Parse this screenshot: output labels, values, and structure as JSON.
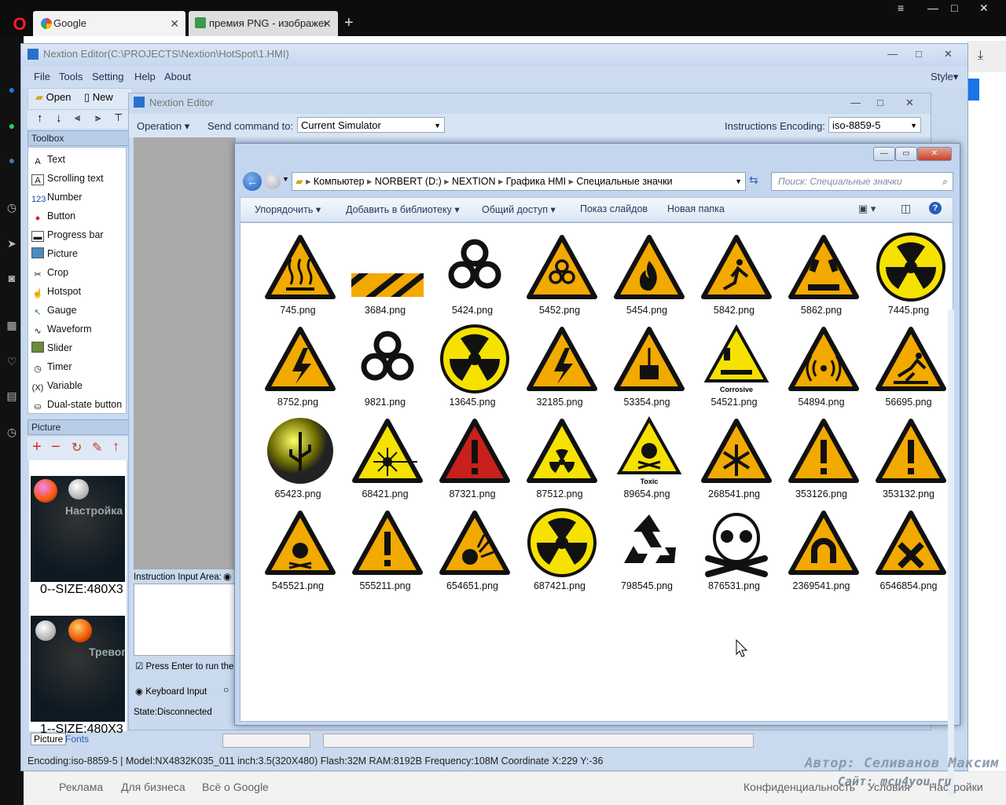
{
  "browser": {
    "tabs": [
      {
        "label": "Google"
      },
      {
        "label": "премия PNG - изображен"
      }
    ],
    "new_tab": "+",
    "footer_links": [
      "Реклама",
      "Для бизнеса",
      "Всё о Google",
      "Конфиденциальность",
      "Условия",
      "Настройки"
    ]
  },
  "nextion": {
    "title": "Nextion Editor(C:\\PROJECTS\\Nextion\\HotSpot\\1.HMI)",
    "menu": [
      "File",
      "Tools",
      "Setting",
      "Help",
      "About"
    ],
    "style_label": "Style",
    "toolbar": {
      "open": "Open",
      "new": "New"
    },
    "toolbox_title": "Toolbox",
    "tools": [
      "Text",
      "Scrolling text",
      "Number",
      "Button",
      "Progress bar",
      "Picture",
      "Crop",
      "Hotspot",
      "Gauge",
      "Waveform",
      "Slider",
      "Timer",
      "Variable",
      "Dual-state button"
    ],
    "picture_title": "Picture",
    "pictures": [
      {
        "caption": "Настройка",
        "label": "0--SIZE:480X3"
      },
      {
        "caption": "Тревог",
        "label": "1--SIZE:480X3"
      }
    ],
    "bottom_tabs": [
      "Picture",
      "Fonts"
    ],
    "inner": {
      "title": "Nextion Editor",
      "operation": "Operation",
      "send_command_label": "Send command to:",
      "send_command_value": "Current Simulator",
      "encoding_label": "Instructions Encoding:",
      "encoding_value": "iso-8859-5",
      "instruction_area_label": "Instruction Input Area:",
      "press_enter_label": "Press Enter to run the I",
      "keyboard_input_label": "Keyboard Input",
      "state": "State:Disconnected"
    },
    "status_bar": "Encoding:iso-8859-5 | Model:NX4832K035_011  inch:3.5(320X480) Flash:32M RAM:8192B Frequency:108M     Coordinate X:229  Y:-36"
  },
  "explorer": {
    "breadcrumb": [
      "Компьютер",
      "NORBERT (D:)",
      "NEXTION",
      "Графика HMI",
      "Специальные значки"
    ],
    "search_placeholder": "Поиск: Специальные значки",
    "commands": [
      "Упорядочить",
      "Добавить в библиотеку",
      "Общий доступ",
      "Показ слайдов",
      "Новая папка"
    ],
    "files": [
      {
        "name": "745.png",
        "icon": "hot-surface-warning-icon"
      },
      {
        "name": "3684.png",
        "icon": "hazard-stripe-icon"
      },
      {
        "name": "5424.png",
        "icon": "biohazard-icon"
      },
      {
        "name": "5452.png",
        "icon": "biohazard-warning-icon"
      },
      {
        "name": "5454.png",
        "icon": "flammable-warning-icon"
      },
      {
        "name": "5842.png",
        "icon": "fall-hazard-icon"
      },
      {
        "name": "5862.png",
        "icon": "corrosive-warning-icon"
      },
      {
        "name": "7445.png",
        "icon": "radiation-icon"
      },
      {
        "name": "8752.png",
        "icon": "electric-warning-icon"
      },
      {
        "name": "9821.png",
        "icon": "biohazard-icon"
      },
      {
        "name": "13645.png",
        "icon": "radiation-icon"
      },
      {
        "name": "32185.png",
        "icon": "electric-warning-icon"
      },
      {
        "name": "53354.png",
        "icon": "suspended-load-icon"
      },
      {
        "name": "54521.png",
        "icon": "corrosive-label-icon",
        "caption": "Corrosive"
      },
      {
        "name": "54894.png",
        "icon": "non-ionizing-radiation-icon"
      },
      {
        "name": "56695.png",
        "icon": "trip-hazard-icon"
      },
      {
        "name": "65423.png",
        "icon": "usb-button-icon"
      },
      {
        "name": "68421.png",
        "icon": "laser-warning-icon"
      },
      {
        "name": "87321.png",
        "icon": "red-exclamation-icon"
      },
      {
        "name": "87512.png",
        "icon": "radiation-warning-icon"
      },
      {
        "name": "89654.png",
        "icon": "toxic-label-icon",
        "caption": "Toxic"
      },
      {
        "name": "268541.png",
        "icon": "low-temperature-icon"
      },
      {
        "name": "353126.png",
        "icon": "exclamation-warning-icon"
      },
      {
        "name": "353132.png",
        "icon": "exclamation-warning-icon"
      },
      {
        "name": "545521.png",
        "icon": "toxic-warning-icon"
      },
      {
        "name": "555211.png",
        "icon": "exclamation-warning-icon"
      },
      {
        "name": "654651.png",
        "icon": "explosive-warning-icon"
      },
      {
        "name": "687421.png",
        "icon": "radiation-icon"
      },
      {
        "name": "798545.png",
        "icon": "recycle-icon"
      },
      {
        "name": "876531.png",
        "icon": "skull-crossbones-icon"
      },
      {
        "name": "2369541.png",
        "icon": "magnetic-field-icon"
      },
      {
        "name": "6546854.png",
        "icon": "harmful-x-icon"
      }
    ]
  },
  "watermark": {
    "author": "Автор: Селиванов Максим",
    "site": "Сайт: mcu4you.ru"
  },
  "colors": {
    "warning_yellow": "#f2a900",
    "nextion_blue": "#c9d9ee",
    "explorer_frame": "#c4d6ee"
  }
}
